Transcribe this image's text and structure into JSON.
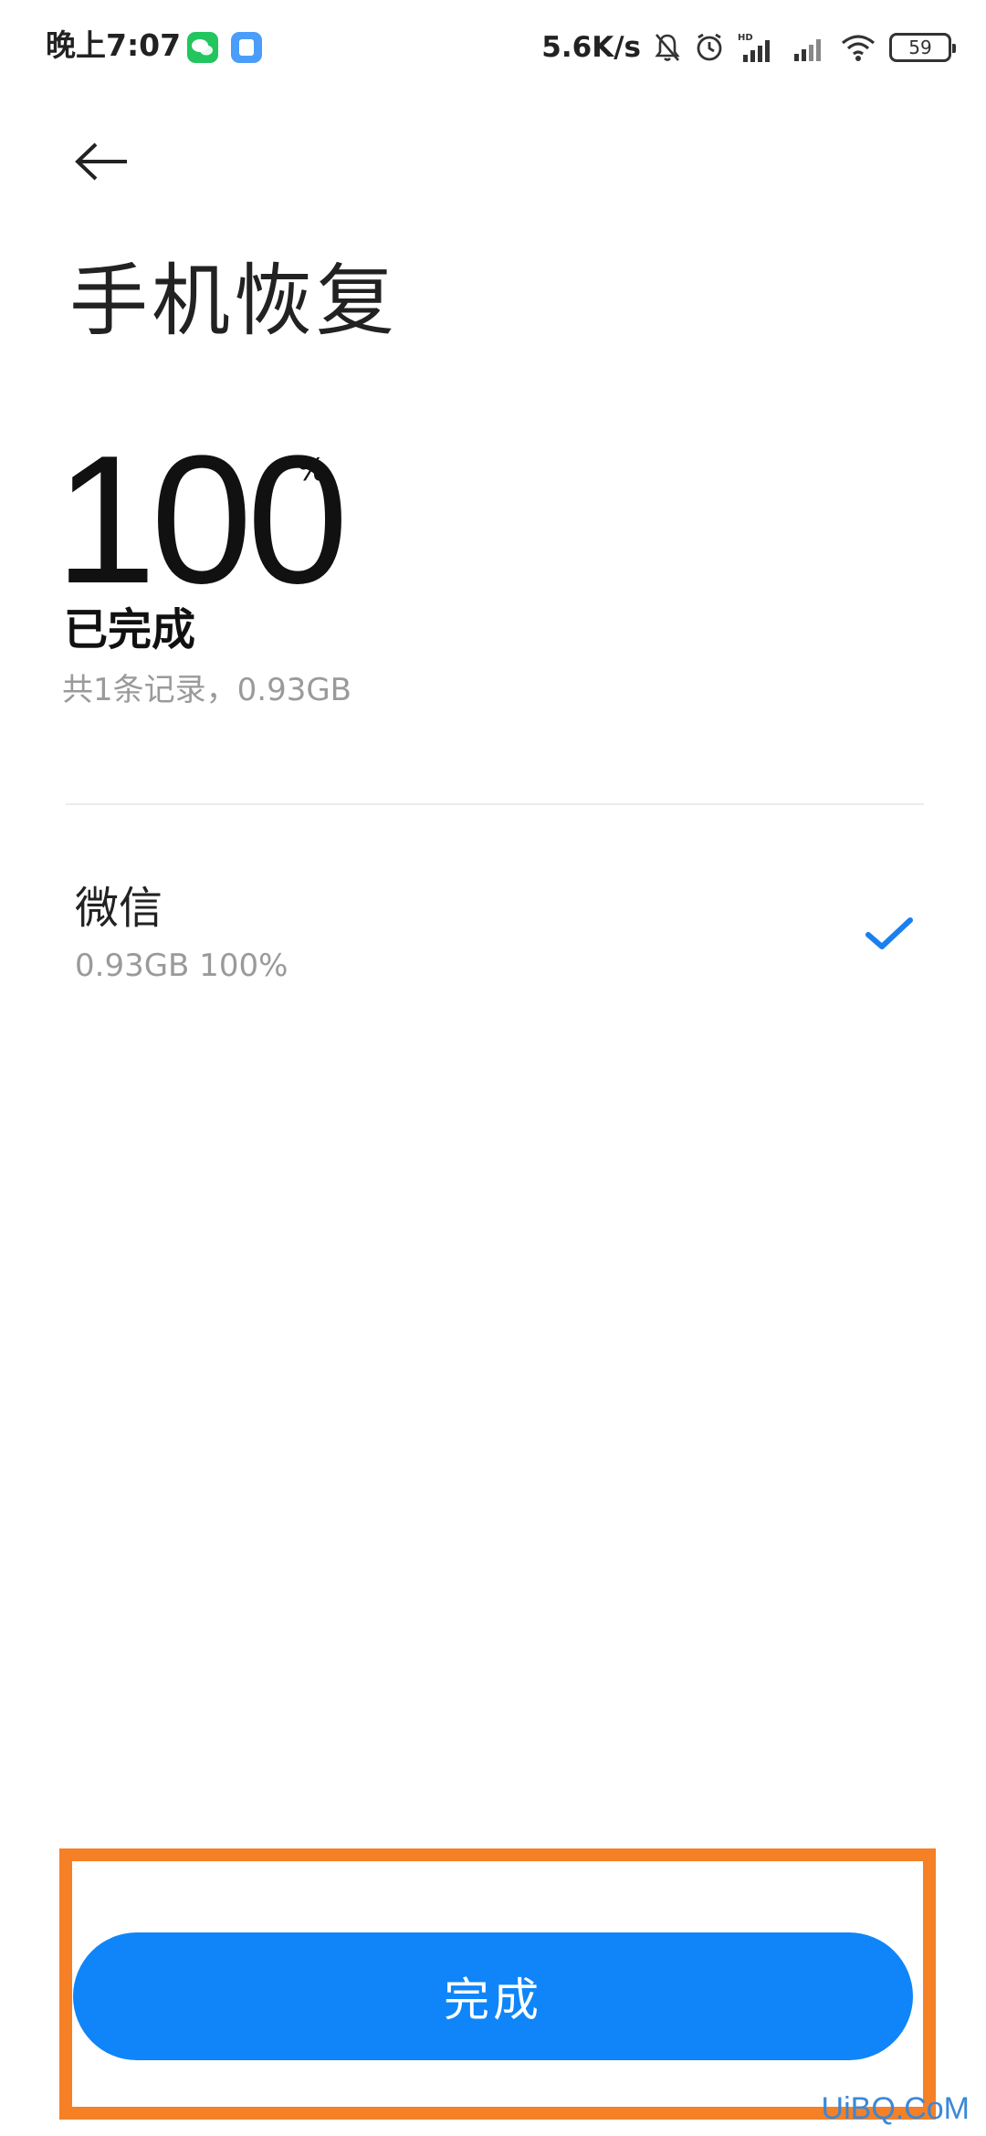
{
  "status_bar": {
    "time": "晚上7:07",
    "network_speed": "5.6K/s",
    "hd_label": "HD",
    "battery": "59",
    "icons": [
      "wechat-icon",
      "notes-app-icon",
      "mute-bell-icon",
      "alarm-icon",
      "hd-signal-icon",
      "signal-icon",
      "wifi-icon",
      "battery-icon"
    ]
  },
  "header": {
    "back_icon": "back-arrow-icon",
    "title": "手机恢复"
  },
  "progress": {
    "value": "100",
    "unit": "%",
    "status": "已完成",
    "summary": "共1条记录，0.93GB"
  },
  "items": [
    {
      "name": "微信",
      "detail": "0.93GB 100%",
      "state_icon": "check-icon"
    }
  ],
  "done_button": {
    "label": "完成"
  },
  "watermark": "UiBQ.CoM",
  "colors": {
    "accent": "#0f85f9",
    "highlight_border": "#f58026",
    "secondary_text": "#9a9a9a"
  }
}
